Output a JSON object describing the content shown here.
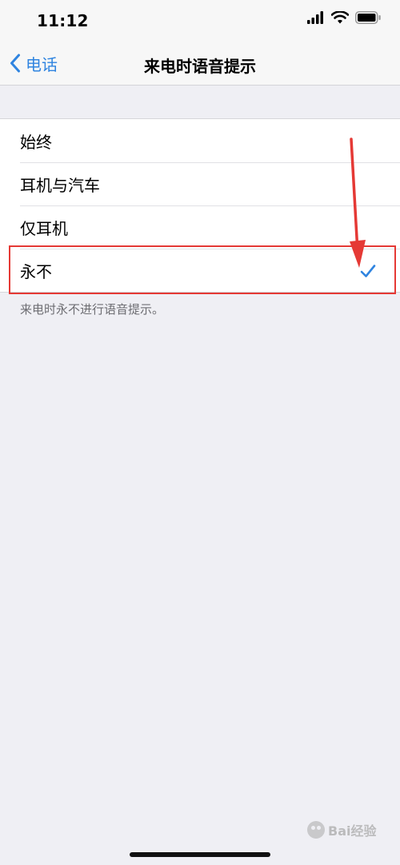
{
  "status_bar": {
    "time": "11:12"
  },
  "nav": {
    "back_label": "电话",
    "title": "来电时语音提示"
  },
  "options": [
    {
      "label": "始终",
      "selected": false
    },
    {
      "label": "耳机与汽车",
      "selected": false
    },
    {
      "label": "仅耳机",
      "selected": false
    },
    {
      "label": "永不",
      "selected": true
    }
  ],
  "footer_note": "来电时永不进行语音提示。",
  "watermark": {
    "text": "Bai经验"
  },
  "colors": {
    "accent": "#2f84e0",
    "annotation": "#e53935",
    "background": "#efeff4"
  },
  "icons": [
    "signal-icon",
    "wifi-icon",
    "battery-icon",
    "chevron-left-icon",
    "checkmark-icon",
    "arrow-annotation",
    "watermark-logo-icon"
  ]
}
